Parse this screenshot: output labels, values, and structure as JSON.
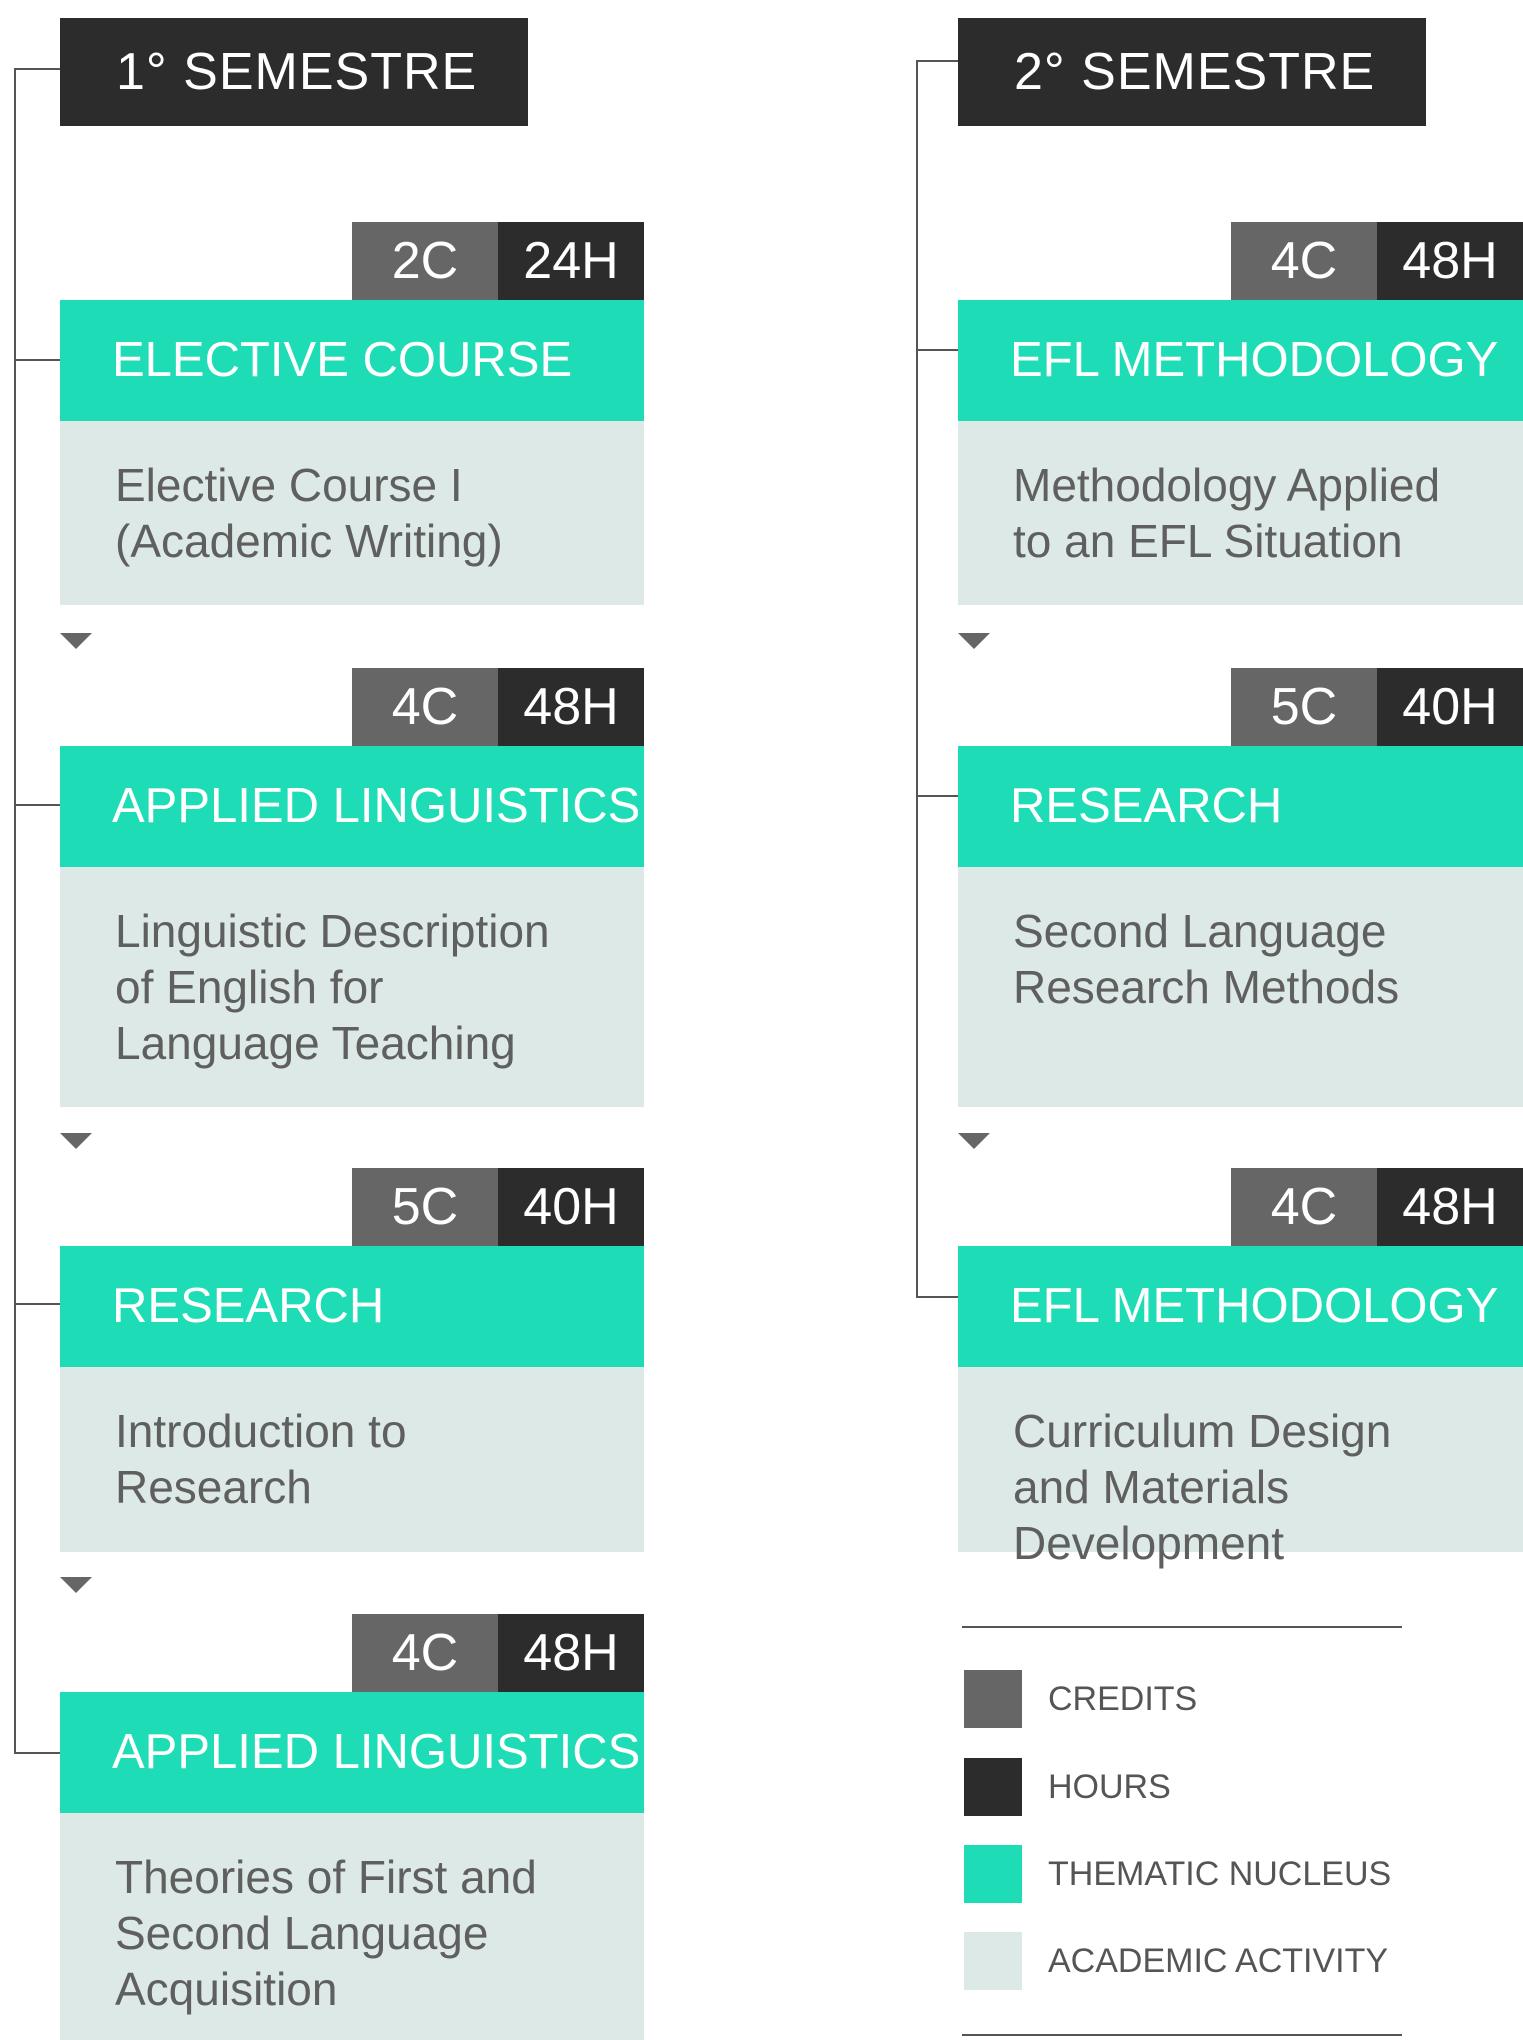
{
  "semesters": [
    {
      "title": "1° SEMESTRE",
      "courses": [
        {
          "credits": "2C",
          "hours": "24H",
          "nucleus": "ELECTIVE COURSE",
          "activity": "Elective Course I (Academic Writing)"
        },
        {
          "credits": "4C",
          "hours": "48H",
          "nucleus": "APPLIED LINGUISTICS",
          "activity": "Linguistic Description of English for Language Teaching"
        },
        {
          "credits": "5C",
          "hours": "40H",
          "nucleus": "RESEARCH",
          "activity": "Introduction to Research"
        },
        {
          "credits": "4C",
          "hours": "48H",
          "nucleus": "APPLIED LINGUISTICS",
          "activity": "Theories of First and Second Language Acquisition"
        }
      ]
    },
    {
      "title": "2° SEMESTRE",
      "courses": [
        {
          "credits": "4C",
          "hours": "48H",
          "nucleus": "EFL METHODOLOGY",
          "activity": "Methodology Applied to an EFL Situation"
        },
        {
          "credits": "5C",
          "hours": "40H",
          "nucleus": "RESEARCH",
          "activity": "Second Language Research Methods"
        },
        {
          "credits": "4C",
          "hours": "48H",
          "nucleus": "EFL METHODOLOGY",
          "activity": "Curriculum Design and Materials Development"
        }
      ]
    }
  ],
  "legend": [
    {
      "label": "CREDITS",
      "color": "#666666"
    },
    {
      "label": "HOURS",
      "color": "#2c2c2c"
    },
    {
      "label": "THEMATIC NUCLEUS",
      "color": "#1edcb5"
    },
    {
      "label": "ACADEMIC ACTIVITY",
      "color": "#dce9e6"
    }
  ],
  "colors": {
    "credits": "#666666",
    "hours": "#2c2c2c",
    "nucleus": "#1edcb5",
    "activity": "#dce9e6",
    "header": "#2c2c2c"
  }
}
